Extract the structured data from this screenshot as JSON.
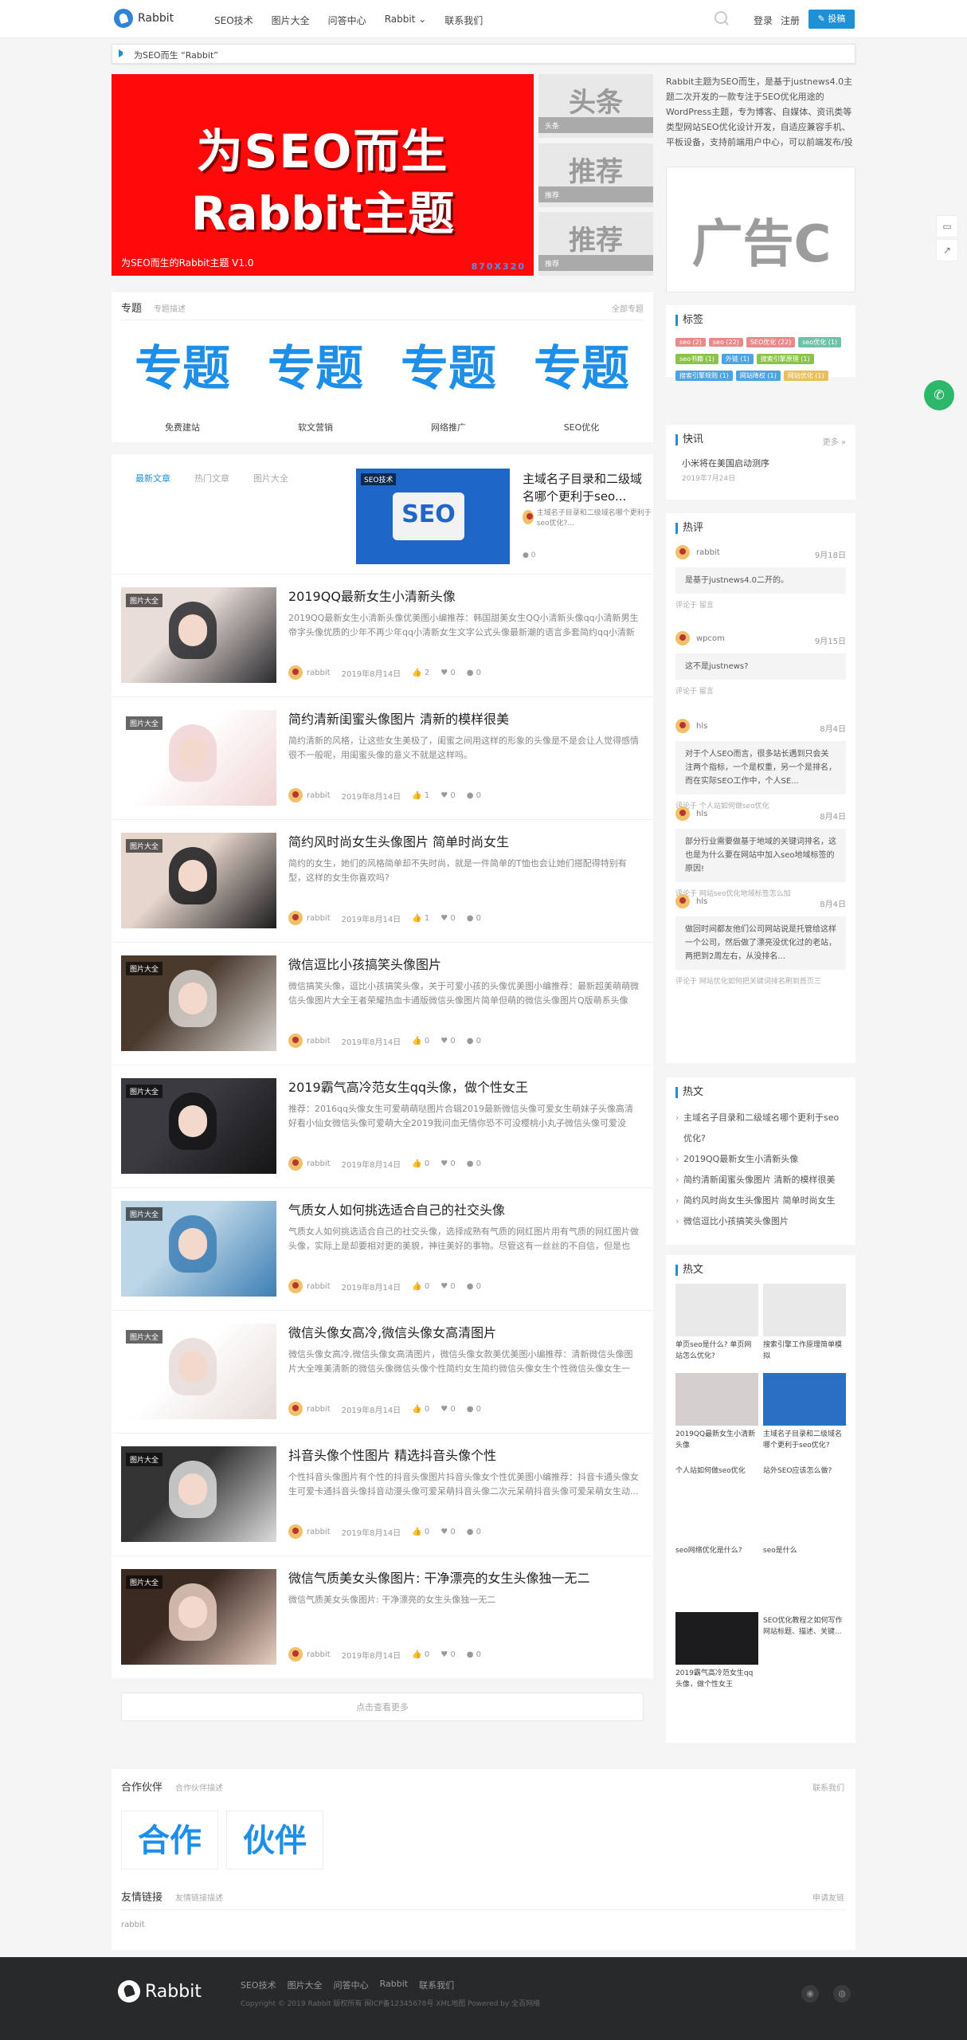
{
  "nav": {
    "logo": "Rabbit",
    "menu": [
      "SEO技术",
      "图片大全",
      "问答中心",
      "Rabbit ⌄",
      "联系我们"
    ],
    "login": "登录",
    "register": "注册",
    "post": "✎ 投稿"
  },
  "notice": "为SEO而生 “Rabbit”",
  "banner": {
    "line1": "为SEO而生",
    "line2": "Rabbit主题",
    "caption": "为SEO而生的Rabbit主题 V1.0",
    "size": "870X320"
  },
  "side_thumbs": [
    {
      "big": "头条",
      "label": "头条"
    },
    {
      "big": "推荐",
      "label": "推荐"
    },
    {
      "big": "推荐",
      "label": "推荐"
    }
  ],
  "about": "Rabbit主题为SEO而生，是基于justnews4.0主题二次开发的一款专注于SEO优化用途的WordPress主题，专为博客、自媒体、资讯类等类型网站SEO优化设计开发，自适应兼容手机、平板设备，支持前端用户中心，可以前端发布/投",
  "ad": "广告C",
  "topic": {
    "title": "专题",
    "sub": "专题描述",
    "all": "全部专题",
    "items": [
      {
        "img": "专题",
        "name": "免费建站"
      },
      {
        "img": "专题",
        "name": "软文营销"
      },
      {
        "img": "专题",
        "name": "网络推广"
      },
      {
        "img": "专题",
        "name": "SEO优化"
      }
    ]
  },
  "tabbox": {
    "tabs": [
      "最新文章",
      "热门文章",
      "图片大全"
    ],
    "label": "SEO技术",
    "featured": {
      "title": "主域名子目录和二级域名哪个更利于seo...",
      "excerpt": "主域名子目录和二级域名哪个更利于seo优化?...",
      "comments": "0"
    },
    "img": "SEO"
  },
  "articles": [
    {
      "tag": "图片大全",
      "title": "2019QQ最新女生小清新头像",
      "excerpt": "2019QQ最新女生小清新头像优美图小编推荐：韩国甜美女生QQ小清新头像qq小清新男生帝字头像优质的少年不再少年qq小清新女生文字公式头像最新潮的语言多套简约qq小清新女...",
      "author": "rabbit",
      "date": "2019年8月14日",
      "likes": "2",
      "favs": "0",
      "comments": "0",
      "palette": [
        "#2a2a2e",
        "#e8ddd8"
      ]
    },
    {
      "tag": "图片大全",
      "title": "简约清新闺蜜头像图片 清新的模样很美",
      "excerpt": "简约清新的风格，让这些女生美极了，闺蜜之间用这样的形象的头像是不是会让人觉得感情很不一般呢，用闺蜜头像的意义不就是这样吗。",
      "author": "rabbit",
      "date": "2019年8月14日",
      "likes": "1",
      "favs": "0",
      "comments": "0",
      "palette": [
        "#f0d4d4",
        "#ffffff"
      ]
    },
    {
      "tag": "图片大全",
      "title": "简约风时尚女生头像图片 简单时尚女生",
      "excerpt": "简约的女生，她们的风格简单却不失时尚，就是一件简单的T恤也会让她们搭配得特别有型，这样的女生你喜欢吗?",
      "author": "rabbit",
      "date": "2019年8月14日",
      "likes": "1",
      "favs": "0",
      "comments": "0",
      "palette": [
        "#1a1a1c",
        "#e6d6cc"
      ]
    },
    {
      "tag": "图片大全",
      "title": "微信逗比小孩搞笑头像图片",
      "excerpt": "微信搞笑头像，逗比小孩搞笑头像，关于可爱小孩的头像优美图小编推荐：最新超美萌萌微信头像图片大全王者荣耀热血卡通版微信头像图片简单但萌的微信头像图片Q版萌系头像",
      "author": "rabbit",
      "date": "2019年8月14日",
      "likes": "0",
      "favs": "0",
      "comments": "0",
      "palette": [
        "#d9d4cf",
        "#4a3a2e"
      ]
    },
    {
      "tag": "图片大全",
      "title": "2019霸气高冷范女生qq头像，做个性女王",
      "excerpt": "推荐：2016qq头像女生可爱萌萌哒图片合辑2019最新微信头像可爱女生萌妹子头像高清好看小仙女微信头像可爱萌大全2019我问血无情你恐不可没樱桃小丸子微信头像可爱没有...",
      "author": "rabbit",
      "date": "2019年8月14日",
      "likes": "0",
      "favs": "0",
      "comments": "0",
      "palette": [
        "#151517",
        "#3a3a40"
      ]
    },
    {
      "tag": "图片大全",
      "title": "气质女人如何挑选适合自己的社交头像",
      "excerpt": "气质女人如何挑选适合自己的社交头像，选择成熟有气质的网红图片用有气质的网红图片做头像，实际上是却要相对更的美貌，神往美好的事物。尽管这有一丝丝的不自信，但是也能...",
      "author": "rabbit",
      "date": "2019年8月14日",
      "likes": "0",
      "favs": "0",
      "comments": "0",
      "palette": [
        "#3d7fb5",
        "#bcd6e6"
      ]
    },
    {
      "tag": "图片大全",
      "title": "微信头像女高冷,微信头像女高清图片",
      "excerpt": "微信头像女高冷,微信头像女高清图片，微信头像女款美优美图小编推荐：清新微信头像图片大全唯美清新的微信头像微信头像个性简约女生简约微信头像女生个性微信头像女生一抹...",
      "author": "rabbit",
      "date": "2019年8月14日",
      "likes": "0",
      "favs": "0",
      "comments": "0",
      "palette": [
        "#e6dcd8",
        "#ffffff"
      ]
    },
    {
      "tag": "图片大全",
      "title": "抖音头像个性图片 精选抖音头像个性",
      "excerpt": "个性抖音头像图片有个性的抖音头像图片抖音头像女个性优美图小编推荐：抖音卡通头像女生可爱卡通抖音头像抖音动漫头像可爱呆萌抖音头像二次元呆萌抖音头像可爱呆萌女生动...",
      "author": "rabbit",
      "date": "2019年8月14日",
      "likes": "0",
      "favs": "0",
      "comments": "0",
      "palette": [
        "#dcdcdc",
        "#333333"
      ]
    },
    {
      "tag": "图片大全",
      "title": "微信气质美女头像图片: 干净漂亮的女生头像独一无二",
      "excerpt": "微信气质美女头像图片: 干净漂亮的女生头像独一无二",
      "author": "rabbit",
      "date": "2019年8月14日",
      "likes": "0",
      "favs": "0",
      "comments": "0",
      "palette": [
        "#e9cfc2",
        "#3b2a22"
      ]
    }
  ],
  "more": "点击查看更多",
  "tags": {
    "title": "标签",
    "items": [
      {
        "t": "seo (2)",
        "c": "#e88a8a"
      },
      {
        "t": "seo (22)",
        "c": "#e88a8a"
      },
      {
        "t": "SEO优化 (22)",
        "c": "#e88a8a"
      },
      {
        "t": "seo优化 (1)",
        "c": "#6fc1a7"
      },
      {
        "t": "seo书籍 (1)",
        "c": "#8bc34a"
      },
      {
        "t": "外链 (1)",
        "c": "#4fa3e0"
      },
      {
        "t": "搜索引擎原理 (1)",
        "c": "#8bc34a"
      },
      {
        "t": "搜索引擎规则 (1)",
        "c": "#4fa3e0"
      },
      {
        "t": "网站降权 (1)",
        "c": "#4fa3e0"
      },
      {
        "t": "网站优化 (1)",
        "c": "#e6c05a"
      }
    ]
  },
  "news": {
    "title": "快讯",
    "more": "更多 »",
    "item": "小米将在美国启动测序",
    "date": "2019年7月24日"
  },
  "comments": {
    "title": "热评",
    "items": [
      {
        "name": "rabbit",
        "date": "9月18日",
        "body": "是基于justnews4.0二开的。",
        "ft": "评论于 留言"
      },
      {
        "name": "wpcom",
        "date": "9月15日",
        "body": "这不是justnews?",
        "ft": "评论于 留言"
      },
      {
        "name": "hls",
        "date": "8月4日",
        "body": "对于个人SEO而言，很多站长遇到只会关注两个指标，一个是权重，另一个是排名，而在实际SEO工作中，个人SE...",
        "ft": "评论于 个人站如何做seo优化"
      },
      {
        "name": "hls",
        "date": "8月4日",
        "body": "部分行业需要做基于地域的关键词排名，这也是为什么要在网站中加入seo地域标签的原因!",
        "ft": "评论于 网站seo优化地域标签怎么加"
      },
      {
        "name": "hls",
        "date": "8月4日",
        "body": "做回时间都友他们公司网站说是托管给这样一个公司，然后做了漂亮没优化过的老站，两把到2周左右，从没排名...",
        "ft": "评论于 网站优化如何把关键词排名刷到首页三"
      }
    ]
  },
  "hotlist": {
    "title": "热文",
    "items": [
      "主域名子目录和二级域名哪个更利于seo优化?",
      "2019QQ最新女生小清新头像",
      "简约清新闺蜜头像图片 清新的模样很美",
      "简约风时尚女生头像图片 简单时尚女生",
      "微信逗比小孩搞笑头像图片"
    ]
  },
  "hotgrid": {
    "title": "热文",
    "items": [
      "单页seo是什么? 单页网站怎么优化?",
      "搜索引擎工作原理简单模拟",
      "2019QQ最新女生小清新头像",
      "主域名子目录和二级域名哪个更利于seo优化?",
      "个人站如何做seo优化",
      "站外SEO应该怎么做?",
      "seo网络优化是什么?",
      "seo是什么",
      "2019霸气高冷范女生qq头像，做个性女王",
      "SEO优化教程之如何写作网站标题、描述、关键..."
    ]
  },
  "partner": {
    "title": "合作伙伴",
    "sub": "合作伙伴描述",
    "link": "联系我们",
    "imgs": [
      "合作",
      "伙伴"
    ],
    "friends": "友情链接",
    "friends_sub": "友情链接描述",
    "apply": "申请友链",
    "friend": "rabbit"
  },
  "footer": {
    "logo": "Rabbit",
    "links": [
      "SEO技术",
      "图片大全",
      "问答中心",
      "Rabbit",
      "联系我们"
    ],
    "copy": "Copyright © 2019 Rabbit 版权所有 闽ICP备12345678号  XML地图  Powered by 全百网络"
  }
}
